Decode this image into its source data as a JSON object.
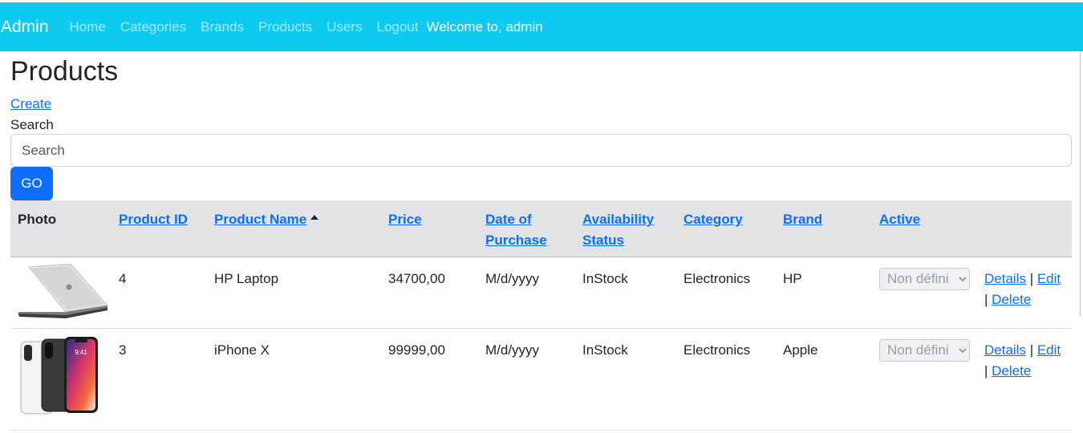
{
  "navbar": {
    "brand": "Admin",
    "links": [
      "Home",
      "Categories",
      "Brands",
      "Products",
      "Users",
      "Logout"
    ],
    "welcome": "Welcome to, admin",
    "color": "#0dcaf0"
  },
  "page": {
    "title": "Products",
    "create_label": "Create",
    "search_label": "Search",
    "search_placeholder": "Search",
    "go_label": "GO"
  },
  "table": {
    "columns": [
      "Photo",
      "Product ID",
      "Product Name",
      "Price",
      "Date of Purchase",
      "Availability Status",
      "Category",
      "Brand",
      "Active"
    ],
    "sorted_column": "Product Name",
    "rows": [
      {
        "photo_icon": "hp-laptop-photo",
        "id": "4",
        "name": "HP Laptop",
        "price": "34700,00",
        "date": "M/d/yyyy",
        "availability": "InStock",
        "category": "Electronics",
        "brand": "HP",
        "active": "Non défini",
        "details": "Details",
        "edit": "Edit",
        "delete": "Delete"
      },
      {
        "photo_icon": "iphone-x-photo",
        "id": "3",
        "name": "iPhone X",
        "price": "99999,00",
        "date": "M/d/yyyy",
        "availability": "InStock",
        "category": "Electronics",
        "brand": "Apple",
        "active": "Non défini",
        "details": "Details",
        "edit": "Edit",
        "delete": "Delete"
      }
    ]
  },
  "colors": {
    "primary": "#0d6efd",
    "table_header_bg": "#e2e3e5"
  }
}
